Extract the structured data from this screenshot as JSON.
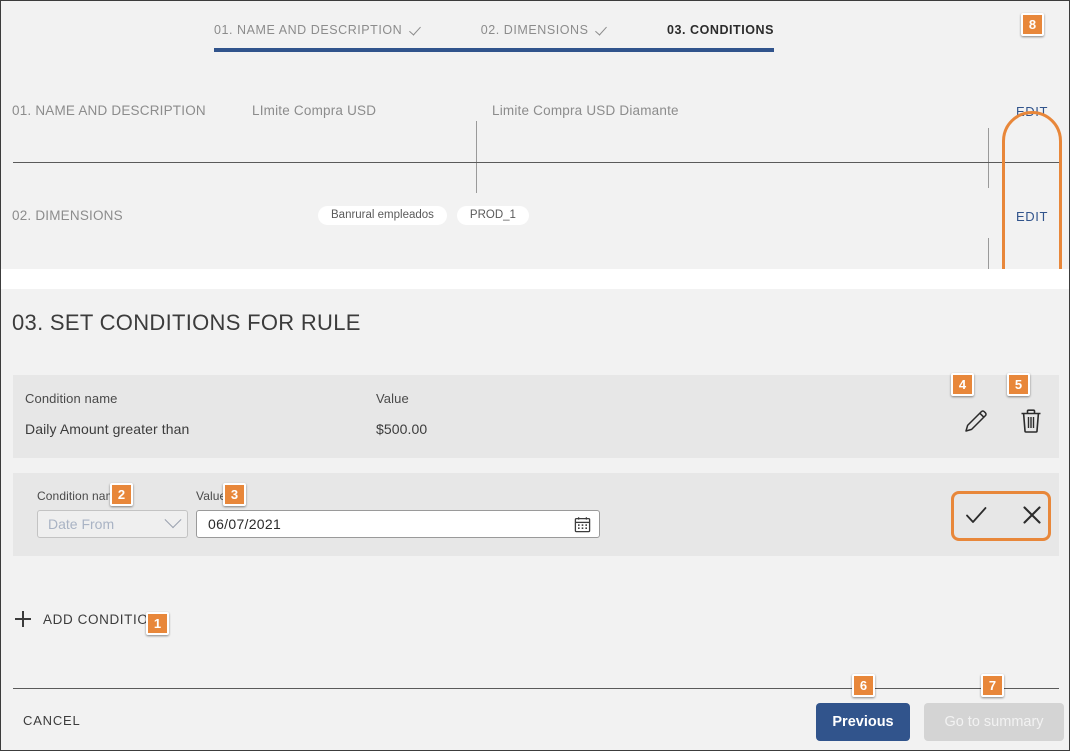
{
  "stepper": {
    "steps": [
      {
        "label": "01. NAME AND DESCRIPTION",
        "state": "done"
      },
      {
        "label": "02. DIMENSIONS",
        "state": "done"
      },
      {
        "label": "03. CONDITIONS",
        "state": "active"
      }
    ]
  },
  "summary": {
    "rows": [
      {
        "label": "01. NAME AND DESCRIPTION",
        "value_1": "LImite Compra USD",
        "value_2": "Limite Compra USD Diamante",
        "edit_label": "EDIT"
      },
      {
        "label": "02. DIMENSIONS",
        "chips": [
          "Banrural empleados",
          "PROD_1"
        ],
        "edit_label": "EDIT"
      }
    ]
  },
  "main": {
    "title": "03. SET CONDITIONS FOR RULE",
    "columns": {
      "condition_name": "Condition name",
      "value": "Value"
    },
    "existing_condition": {
      "name": "Daily Amount greater than",
      "value": "$500.00",
      "edit_icon": "pencil-icon",
      "delete_icon": "trash-icon"
    },
    "edit_row": {
      "condition_label": "Condition name",
      "value_label": "Value",
      "condition_placeholder": "Date From",
      "date_value": "06/07/2021",
      "calendar_icon": "calendar-icon",
      "confirm_icon": "check-icon",
      "cancel_icon": "close-icon"
    },
    "add_condition_label": "ADD CONDITION"
  },
  "footer": {
    "cancel_label": "CANCEL",
    "previous_label": "Previous",
    "summary_label": "Go to summary"
  },
  "annotations": {
    "badges": [
      {
        "id": "1",
        "target": "add-condition-button"
      },
      {
        "id": "2",
        "target": "condition-name-select"
      },
      {
        "id": "3",
        "target": "value-date-input"
      },
      {
        "id": "4",
        "target": "edit-condition-icon"
      },
      {
        "id": "5",
        "target": "delete-condition-icon"
      },
      {
        "id": "6",
        "target": "previous-button"
      },
      {
        "id": "7",
        "target": "go-to-summary-button"
      },
      {
        "id": "8",
        "target": "edit-step-buttons"
      }
    ],
    "highlight_color": "#e8873a"
  },
  "colors": {
    "accent_blue": "#31548c",
    "annotation_orange": "#e8873a",
    "page_background": "#f2f2f2",
    "card_background": "#e7e7e7"
  }
}
